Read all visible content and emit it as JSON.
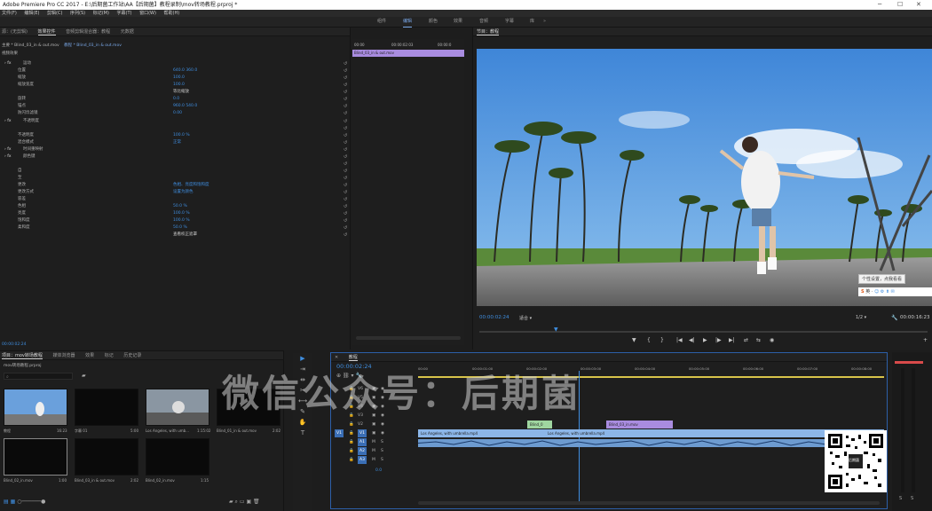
{
  "titlebar": {
    "title": "Adobe Premiere Pro CC 2017 - E:\\后期菌工作站\\AA【后期菌】教程录制\\mov转场教程.prproj *",
    "minimize": "─",
    "maximize": "☐",
    "close": "✕"
  },
  "menu": [
    "文件(F)",
    "编辑(E)",
    "剪辑(C)",
    "序列(S)",
    "标记(M)",
    "字幕(T)",
    "窗口(W)",
    "帮助(H)"
  ],
  "workspaces": [
    "组件",
    "编辑",
    "颜色",
    "效果",
    "音频",
    "字幕",
    "库"
  ],
  "workspace_active": "编辑",
  "effect_controls": {
    "tabs": [
      "源：(无剪辑)",
      "效果控件",
      "音频剪辑混合器：教程",
      "元数据"
    ],
    "active_tab": "效果控件",
    "master": "主要 * Blind_03_in & out.mov",
    "clip": "教程 * Blind_03_in & out.mov",
    "section": "视频效果",
    "rows": [
      {
        "label": "运动",
        "fx": true,
        "value": ""
      },
      {
        "label": "位置",
        "value": "640.0     360.0"
      },
      {
        "label": "缩放",
        "value": "100.0"
      },
      {
        "label": "缩放宽度",
        "value": "100.0"
      },
      {
        "label": "",
        "value": "等比缩放",
        "checkbox": true
      },
      {
        "label": "旋转",
        "value": "0.0"
      },
      {
        "label": "锚点",
        "value": "960.0     540.0"
      },
      {
        "label": "防闪烁滤镜",
        "value": "0.00"
      },
      {
        "label": "不透明度",
        "fx": true,
        "value": ""
      },
      {
        "label": "",
        "value": ""
      },
      {
        "label": "不透明度",
        "value": "100.0 %"
      },
      {
        "label": "混合模式",
        "value": "正常"
      },
      {
        "label": "时间重映射",
        "fx": true,
        "value": ""
      },
      {
        "label": "颜色键",
        "fx": true,
        "value": ""
      },
      {
        "label": "",
        "value": ""
      },
      {
        "label": "自",
        "value": ""
      },
      {
        "label": "至",
        "value": ""
      },
      {
        "label": "更改",
        "value": "色相、亮度和饱和度"
      },
      {
        "label": "更改方式",
        "value": "设置为颜色"
      },
      {
        "label": "容差",
        "value": ""
      },
      {
        "label": "色相",
        "value": "50.0 %"
      },
      {
        "label": "亮度",
        "value": "100.0 %"
      },
      {
        "label": "饱和度",
        "value": "100.0 %"
      },
      {
        "label": "柔和度",
        "value": "50.0 %"
      },
      {
        "label": "",
        "value": "查看校正遮罩",
        "checkbox": true
      }
    ],
    "timecode": "00:00:02:24",
    "ruler": [
      "00:00",
      "00:00:02:03",
      "00:00:0"
    ],
    "clip_bar": "Blind_03_in & out.mov"
  },
  "monitor": {
    "tab": "节目：教程",
    "timecode": "00:00:02:24",
    "fit": "适合",
    "resolution": "1/2",
    "duration": "00:00:16:23",
    "tooltip": "个性设置，点我看看",
    "ime": "英 ·"
  },
  "transport": [
    "▼",
    "{",
    "}",
    "|◀",
    "◀|",
    "▶",
    "|▶",
    "▶|",
    "⇄",
    "⇆",
    "◉"
  ],
  "project": {
    "tabs": [
      "项目：mov转场教程",
      "媒体浏览器",
      "效果",
      "标记",
      "历史记录"
    ],
    "path": "mov转场教程.prproj",
    "items": [
      {
        "name": "教程",
        "dur": "16:23"
      },
      {
        "name": "字幕 01",
        "dur": "5:00"
      },
      {
        "name": "Los Angeles, with umb...",
        "dur": "1:15:02"
      },
      {
        "name": "Blind_01_in & out.mov",
        "dur": "2:02"
      },
      {
        "name": "Blind_02_in.mov",
        "dur": "1:00"
      },
      {
        "name": "Blind_03_in & out.mov",
        "dur": "2:02"
      },
      {
        "name": "Blind_02_in.mov",
        "dur": "1:15"
      }
    ]
  },
  "timeline": {
    "tab": "教程",
    "timecode": "00:00:02:24",
    "ruler": [
      "00:00",
      "00:00:01:00",
      "00:00:02:00",
      "00:00:03:00",
      "00:00:04:00",
      "00:00:05:00",
      "00:00:06:00",
      "00:00:07:00",
      "00:00:08:00"
    ],
    "tracks": [
      "V6",
      "V5",
      "V4",
      "V3",
      "V2",
      "V1",
      "A1",
      "A2",
      "A3"
    ],
    "clips": {
      "v2a": "Blind_0",
      "v2b": "Blind_03_in.mov",
      "v1a": "Los Angeles, with umbrella.mp4",
      "v1b": "Los Angeles, with umbrella.mp4"
    },
    "zero": "0.0"
  },
  "watermark": "微信公众号：后期菌",
  "qr_label": "后期菌"
}
